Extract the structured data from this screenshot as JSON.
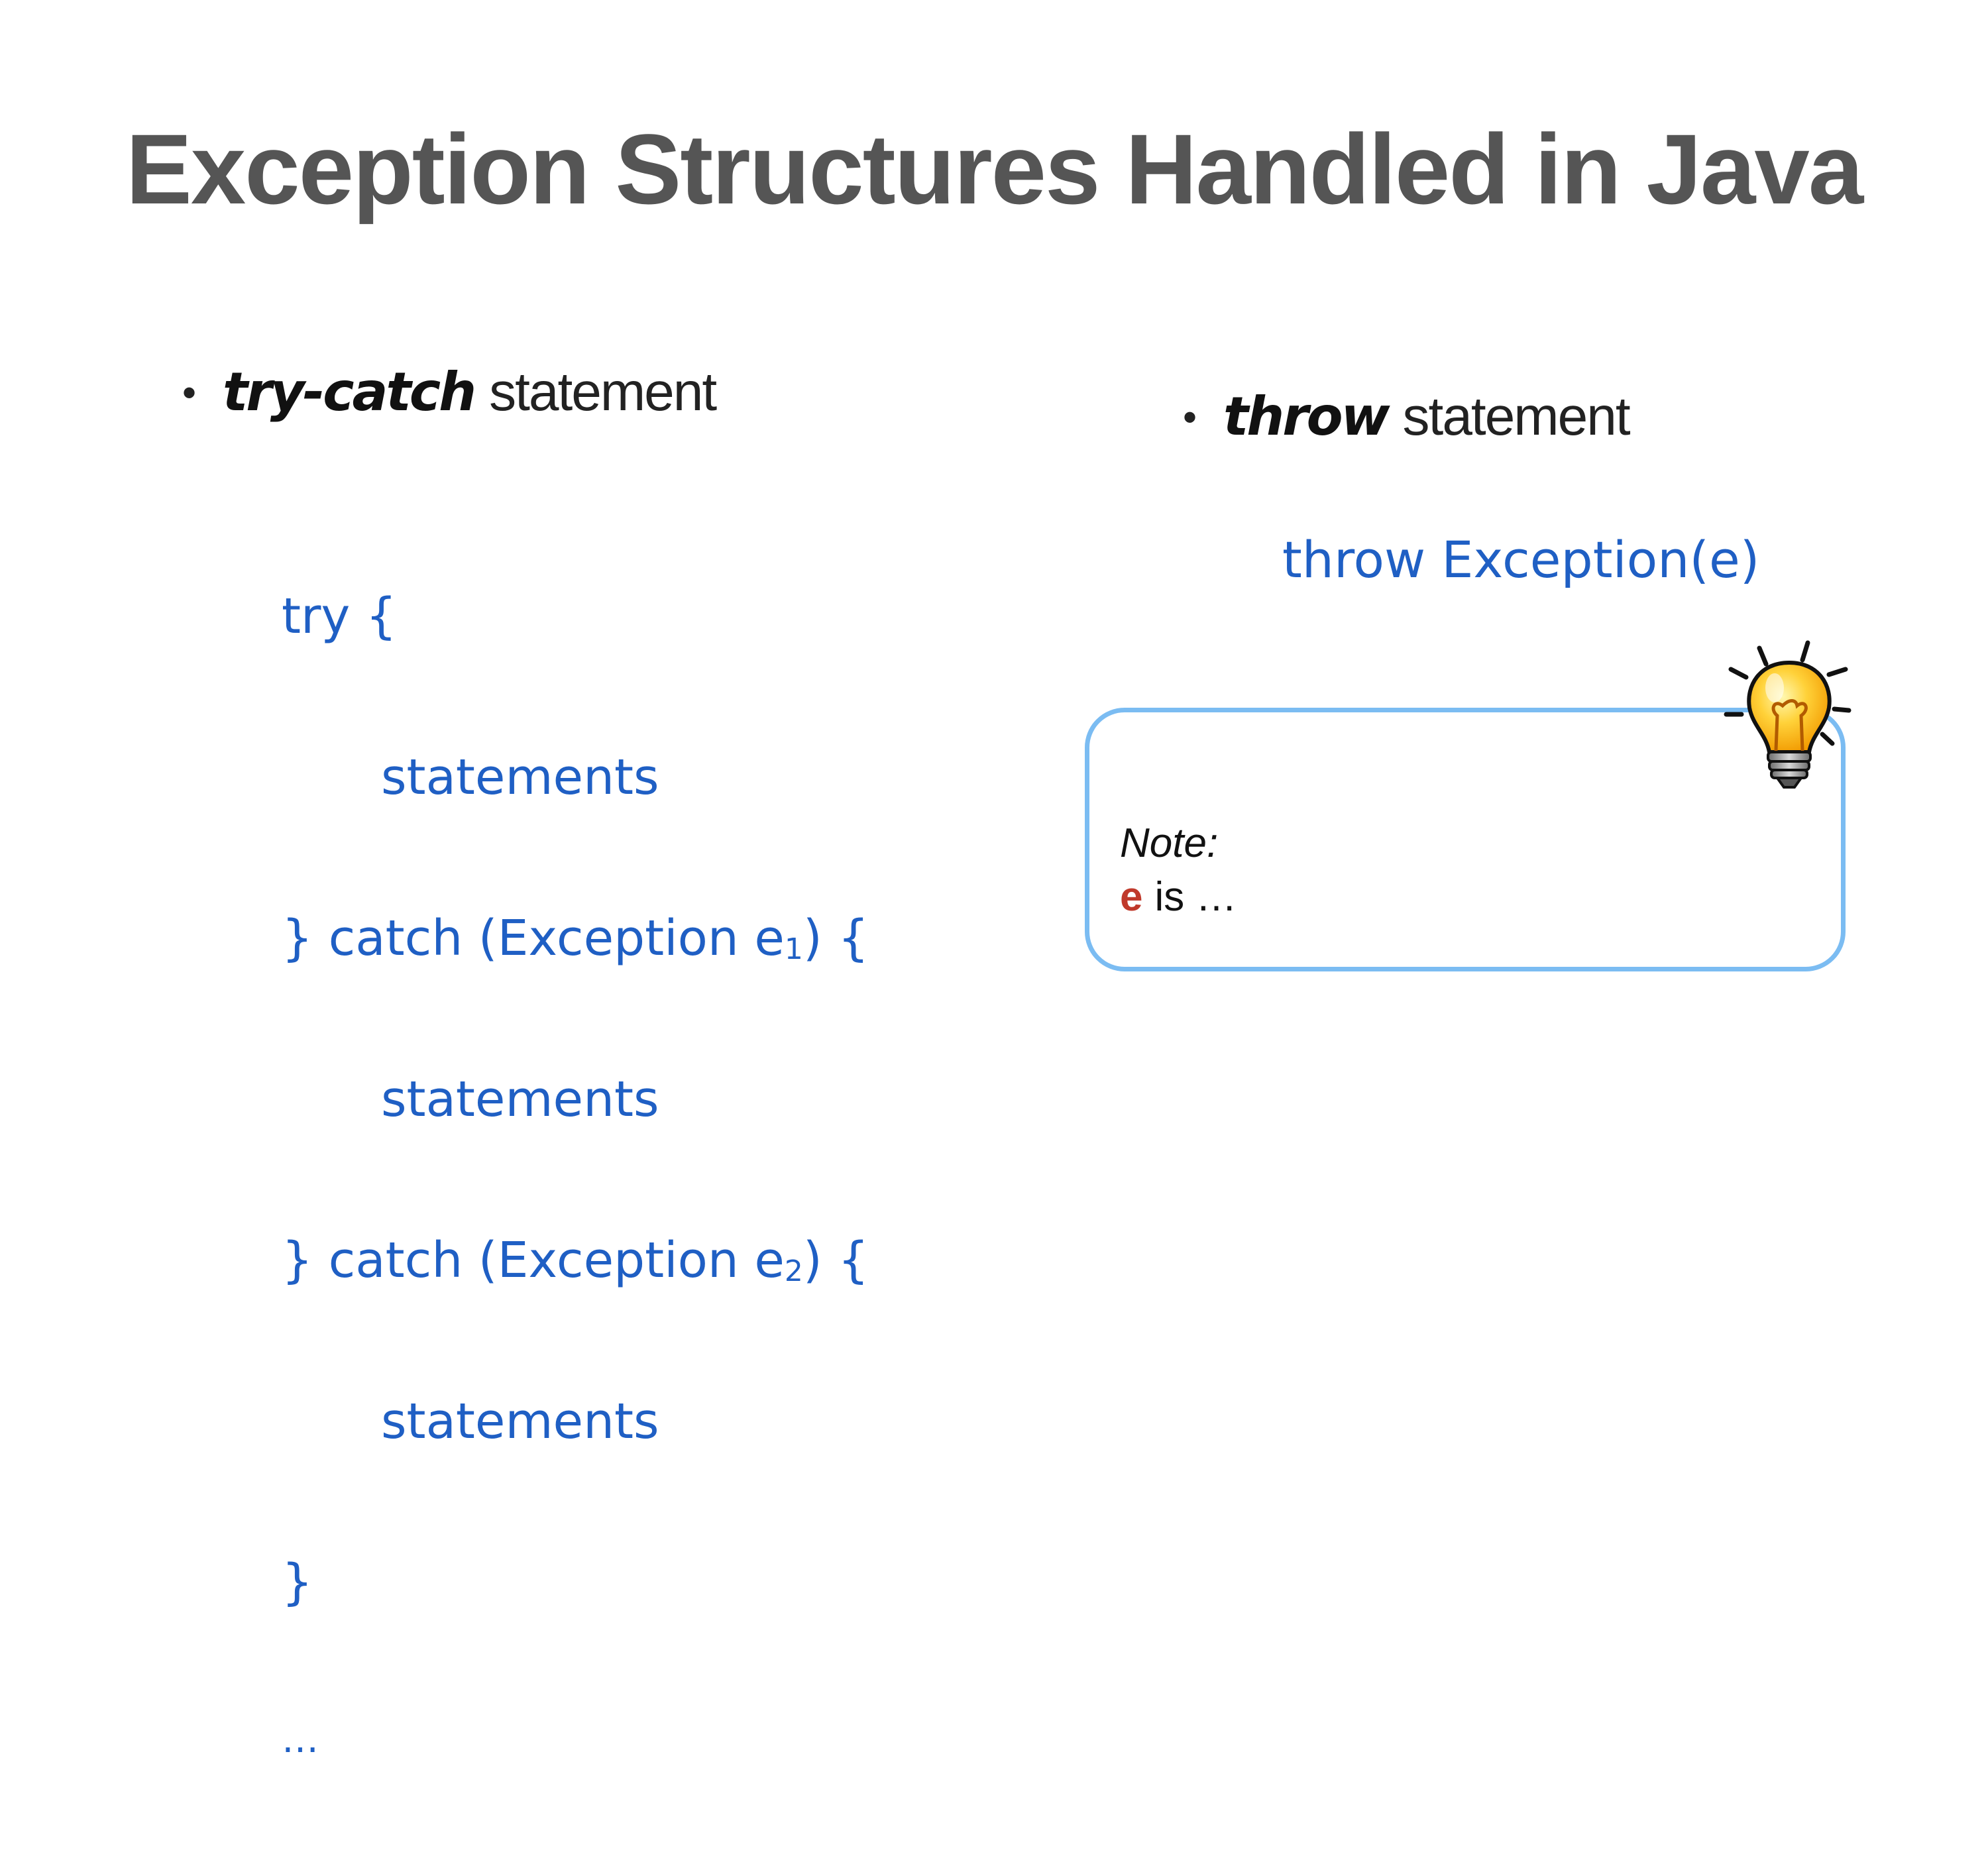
{
  "slide": {
    "title": "Exception Structures Handled in Java",
    "left": {
      "bullet": "•",
      "keyword": "try-catch",
      "rest": "statement",
      "code": {
        "line1": "try {",
        "line2": "statements",
        "line3_prefix": "} catch (Exception e",
        "line3_sub": "1",
        "line3_suffix": ") {",
        "line4": "statements",
        "line5_prefix": "} catch (Exception e",
        "line5_sub": "2",
        "line5_suffix": ") {",
        "line6": "statements",
        "line7": "}",
        "line8": "…"
      }
    },
    "right": {
      "bullet": "•",
      "keyword": "throw",
      "rest": "statement",
      "code": "throw Exception(e)",
      "note": {
        "label": "Note:",
        "var": "e",
        "text": "is …"
      },
      "icon": "lightbulb-icon"
    },
    "colors": {
      "title": "#555555",
      "code": "#1f5fc4",
      "note_border": "#7bbcf2",
      "note_var": "#c0392b"
    }
  }
}
